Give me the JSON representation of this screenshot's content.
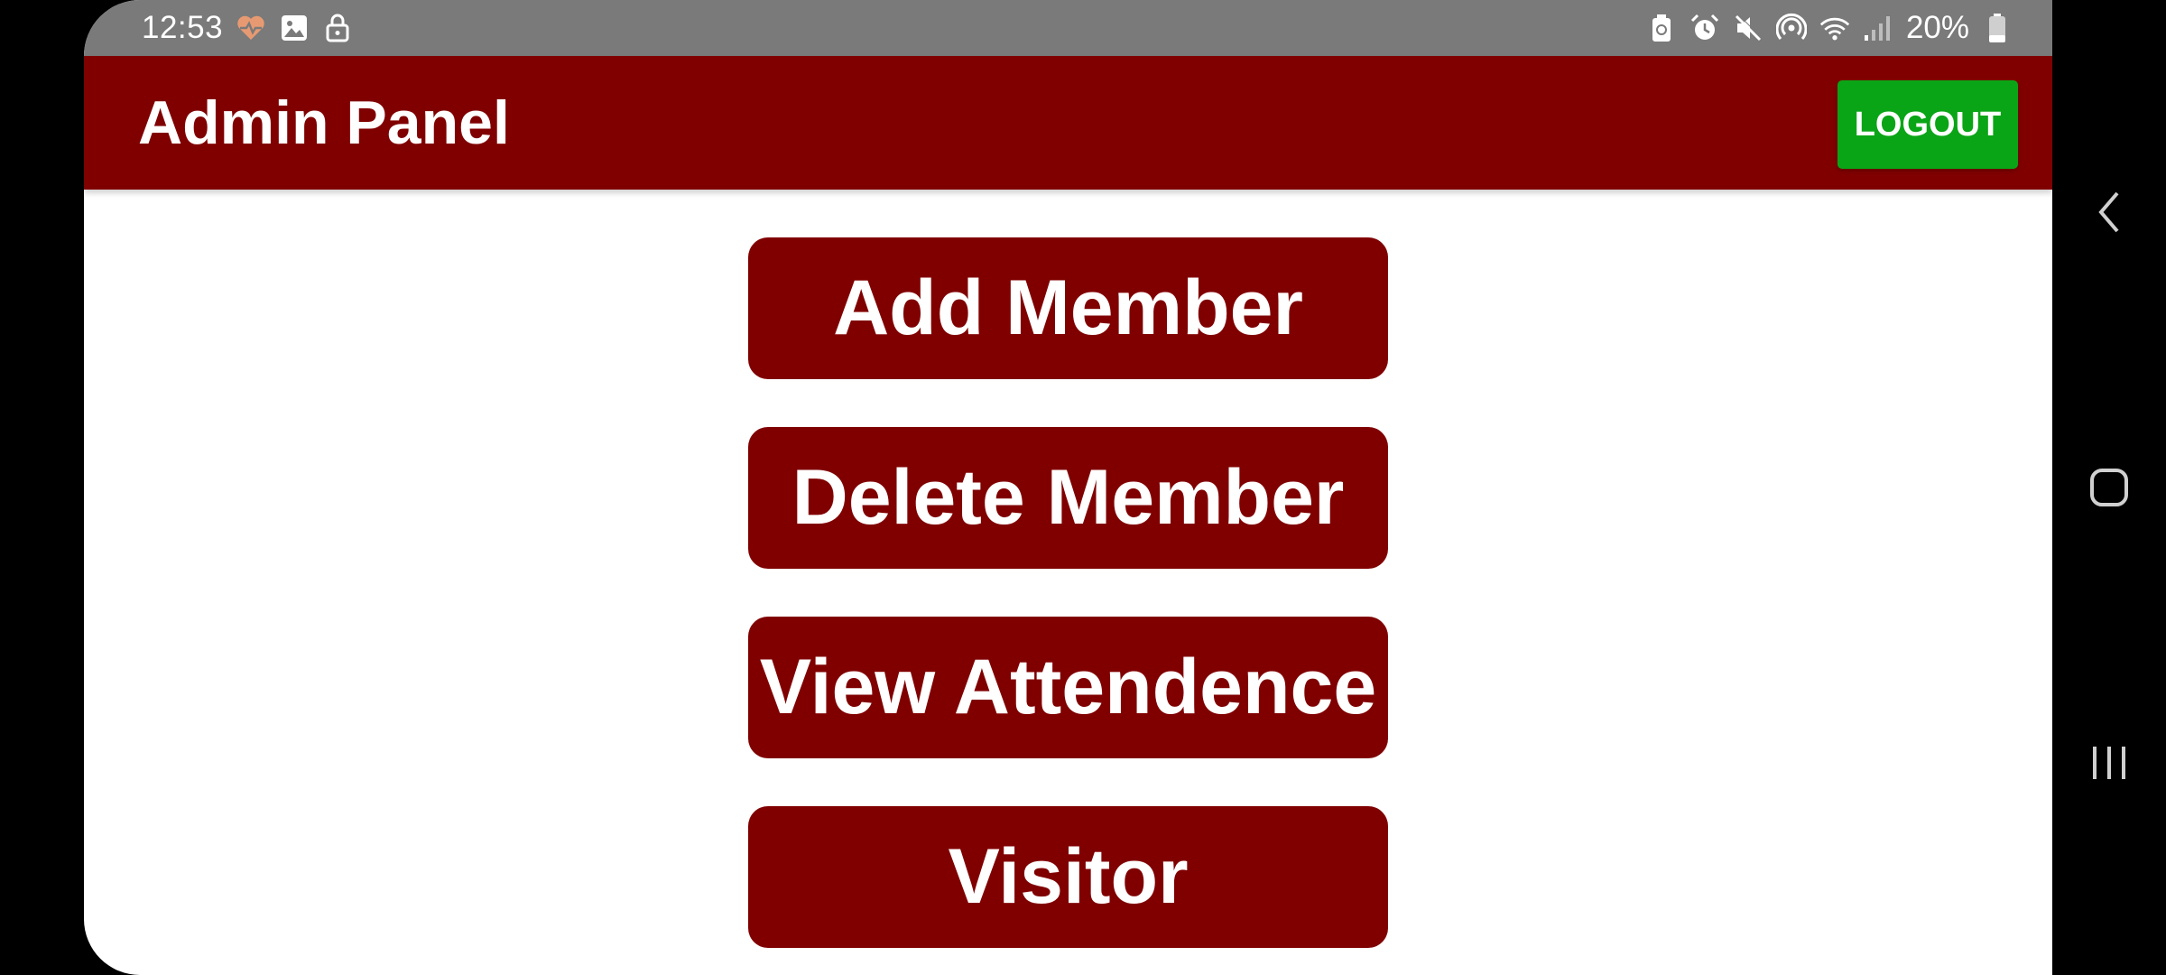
{
  "status_bar": {
    "time": "12:53",
    "left_icons": [
      "health-icon",
      "image-icon",
      "lock-icon"
    ],
    "right_icons": [
      "battery-saver-icon",
      "alarm-icon",
      "mute-icon",
      "hotspot-icon",
      "wifi-icon",
      "signal-icon"
    ],
    "battery_percent": "20%"
  },
  "app_bar": {
    "title": "Admin Panel",
    "logout_label": "LOGOUT",
    "background_color": "#800000",
    "logout_color": "#0aa516"
  },
  "menu": {
    "items": [
      {
        "label": "Add Member"
      },
      {
        "label": "Delete Member"
      },
      {
        "label": "View Attendence"
      },
      {
        "label": "Visitor"
      }
    ],
    "button_color": "#800000"
  },
  "nav_bar": {
    "buttons": [
      "back-icon",
      "home-icon",
      "recents-icon"
    ]
  }
}
